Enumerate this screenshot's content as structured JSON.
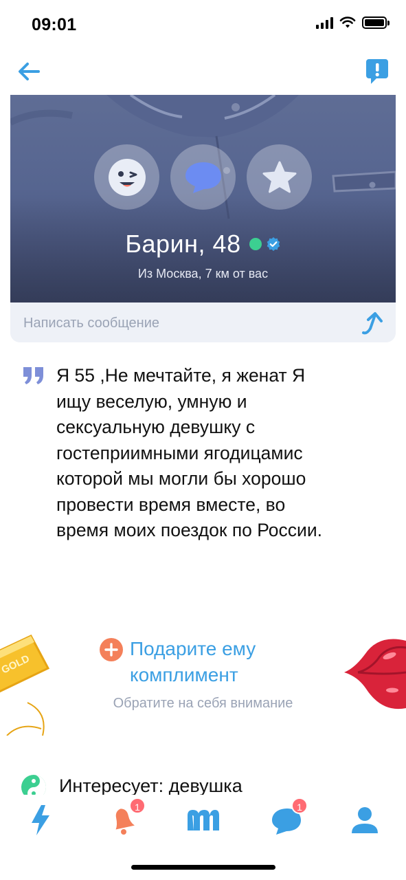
{
  "status_bar": {
    "time": "09:01"
  },
  "profile": {
    "name_age": "Барин, 48",
    "location": "Из Москва, 7 км от вас",
    "actions": [
      "wink-icon",
      "message-icon",
      "star-icon"
    ],
    "online_color": "#3ccf91",
    "verified_color": "#3b9fe3"
  },
  "message_bar": {
    "placeholder": "Написать сообщение"
  },
  "bio": {
    "lines": [
      "Я 55 ,Не мечтайте, я женат Я",
      "ищу веселую, умную и",
      "сексуальную девушку с",
      "гостеприимными ягодицамис",
      "которой мы могли бы хорошо",
      "провести время вместе,  во",
      "время моих поездок по России."
    ]
  },
  "compliment": {
    "title_line1": "Подарите ему",
    "title_line2": "комплимент",
    "subtitle": "Обратите на себя внимание",
    "gold_label": "GOLD"
  },
  "interests": {
    "text": "Интересует: девушка"
  },
  "tab_bar": {
    "tabs": [
      {
        "icon": "lightning-icon",
        "badge": ""
      },
      {
        "icon": "bell-icon",
        "badge": "1"
      },
      {
        "icon": "m-logo-icon",
        "badge": ""
      },
      {
        "icon": "chat-icon",
        "badge": "1"
      },
      {
        "icon": "profile-icon",
        "badge": ""
      }
    ]
  },
  "colors": {
    "accent": "#3b9fe3",
    "badge": "#ff6b73",
    "compliment_plus": "#f4805a"
  }
}
